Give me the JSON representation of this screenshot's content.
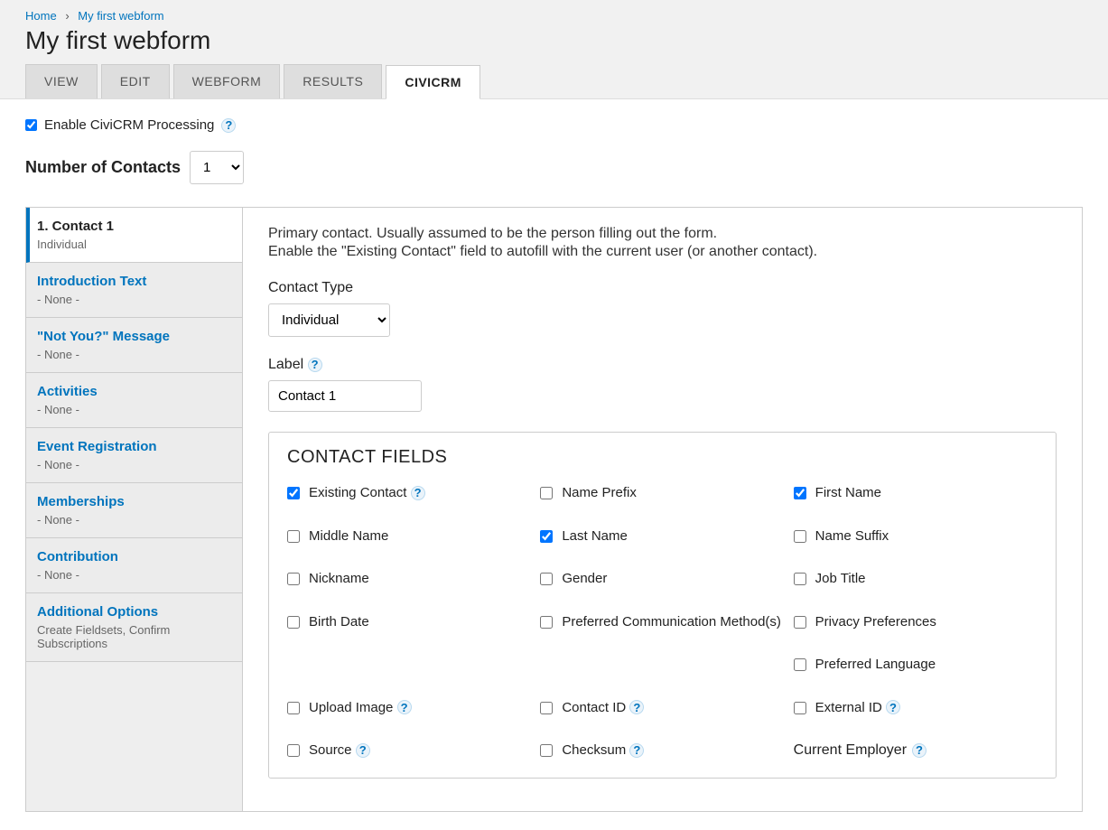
{
  "breadcrumbs": {
    "home": "Home",
    "item": "My first webform"
  },
  "title": "My first webform",
  "tabs": {
    "view": "VIEW",
    "edit": "EDIT",
    "webform": "WEBFORM",
    "results": "RESULTS",
    "civicrm": "CIVICRM"
  },
  "enable": {
    "label": "Enable CiviCRM Processing"
  },
  "contacts": {
    "label": "Number of Contacts",
    "value": "1"
  },
  "sidebar": {
    "items": [
      {
        "title": "1. Contact 1",
        "sub": "Individual"
      },
      {
        "title": "Introduction Text",
        "sub": "- None -"
      },
      {
        "title": "\"Not You?\" Message",
        "sub": "- None -"
      },
      {
        "title": "Activities",
        "sub": "- None -"
      },
      {
        "title": "Event Registration",
        "sub": "- None -"
      },
      {
        "title": "Memberships",
        "sub": "- None -"
      },
      {
        "title": "Contribution",
        "sub": "- None -"
      },
      {
        "title": "Additional Options",
        "sub": "Create Fieldsets, Confirm Subscriptions"
      }
    ]
  },
  "content": {
    "desc1": "Primary contact. Usually assumed to be the person filling out the form.",
    "desc2": "Enable the \"Existing Contact\" field to autofill with the current user (or another contact).",
    "contactType": {
      "label": "Contact Type",
      "value": "Individual"
    },
    "labelField": {
      "label": "Label",
      "value": "Contact 1"
    },
    "fieldsetTitle": "CONTACT FIELDS",
    "fields": {
      "existingContact": "Existing Contact",
      "namePrefix": "Name Prefix",
      "firstName": "First Name",
      "middleName": "Middle Name",
      "lastName": "Last Name",
      "nameSuffix": "Name Suffix",
      "nickname": "Nickname",
      "gender": "Gender",
      "jobTitle": "Job Title",
      "birthDate": "Birth Date",
      "commMethod": "Preferred Communication Method(s)",
      "privacyPrefs": "Privacy Preferences",
      "prefLang": "Preferred Language",
      "uploadImage": "Upload Image",
      "contactId": "Contact ID",
      "externalId": "External ID",
      "source": "Source",
      "checksum": "Checksum",
      "currentEmployer": "Current Employer"
    }
  }
}
